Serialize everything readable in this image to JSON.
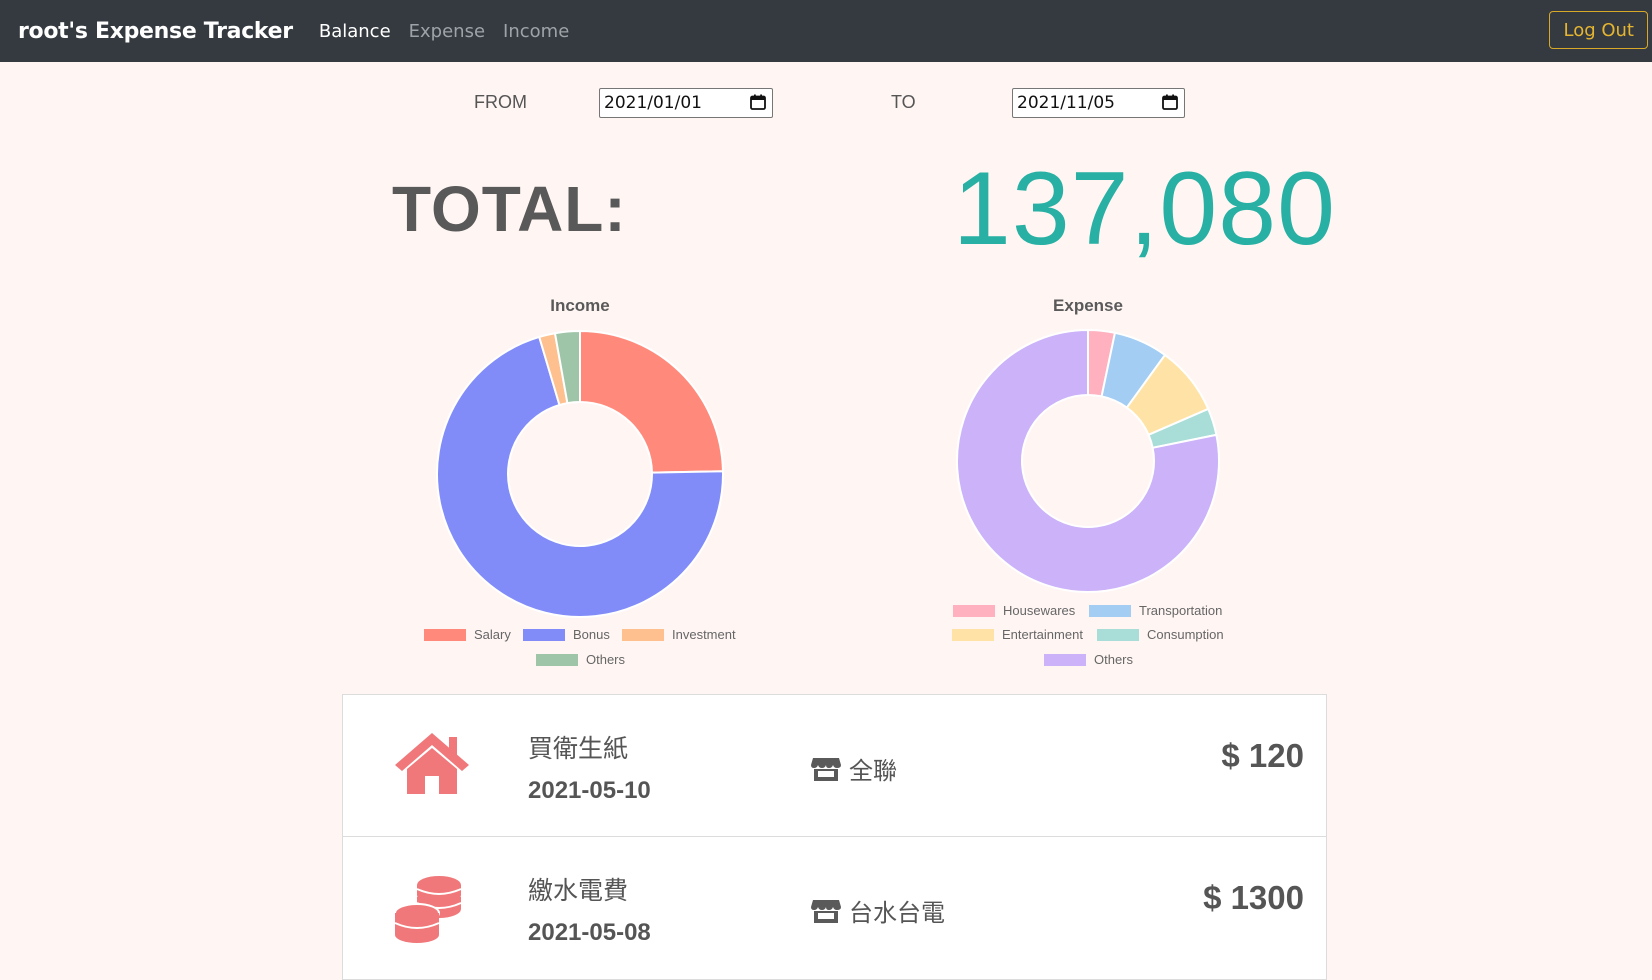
{
  "navbar": {
    "brand": "root's Expense Tracker",
    "links": [
      {
        "label": "Balance",
        "active": true
      },
      {
        "label": "Expense",
        "active": false
      },
      {
        "label": "Income",
        "active": false
      }
    ],
    "logout_label": "Log Out"
  },
  "filter": {
    "from_label": "FROM",
    "from_value": "2021/01/01",
    "to_label": "TO",
    "to_value": "2021/11/05"
  },
  "total": {
    "label": "TOTAL:",
    "value": "137,080"
  },
  "colors": {
    "navbar_bg": "#343a40",
    "page_bg": "#fff6f4",
    "total_value": "#27b0a3",
    "logout_accent": "#e6b530",
    "icon_red": "#f0787a"
  },
  "chart_data": [
    {
      "type": "pie",
      "title": "Income",
      "legend_position": "bottom",
      "labels": [
        "Salary",
        "Bonus",
        "Investment",
        "Others"
      ],
      "values": [
        24.7,
        70.7,
        1.8,
        2.8
      ],
      "colors": [
        "#ff8a7c",
        "#818cf8",
        "#fdc08e",
        "#9fc5a8"
      ]
    },
    {
      "type": "pie",
      "title": "Expense",
      "legend_position": "bottom",
      "labels": [
        "Housewares",
        "Transportation",
        "Entertainment",
        "Consumption",
        "Others"
      ],
      "values": [
        3.3,
        6.7,
        8.5,
        3.3,
        78.2
      ],
      "colors": [
        "#ffb1bf",
        "#a3cdf3",
        "#ffe3a6",
        "#a8ddd8",
        "#cbb2f9"
      ]
    }
  ],
  "records": [
    {
      "icon": "house-icon",
      "name": "買衛生紙",
      "date": "2021-05-10",
      "store_icon": "store-icon",
      "store": "全聯",
      "amount": "$ 120"
    },
    {
      "icon": "coins-icon",
      "name": "繳水電費",
      "date": "2021-05-08",
      "store_icon": "store-icon",
      "store": "台水台電",
      "amount": "$ 1300"
    }
  ]
}
